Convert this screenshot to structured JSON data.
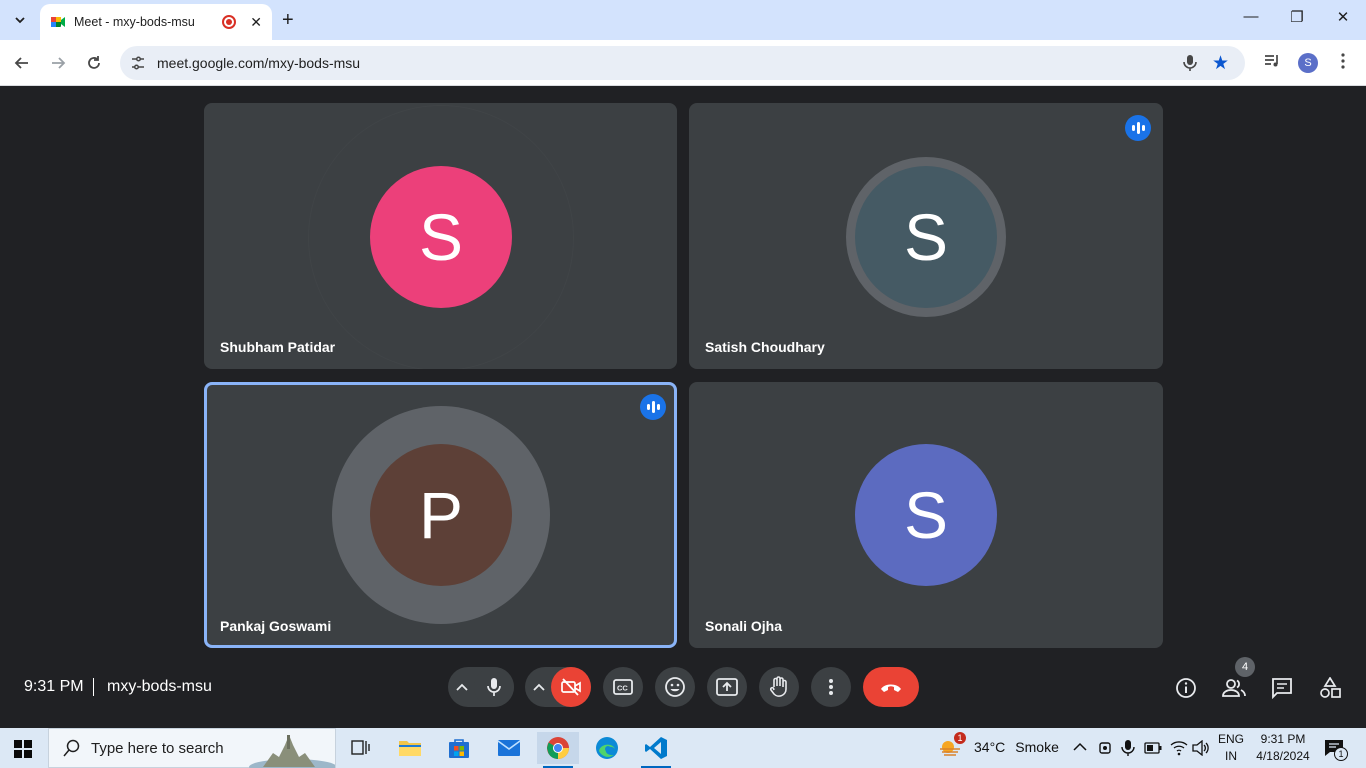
{
  "browser": {
    "tab_title": "Meet - mxy-bods-msu",
    "url": "meet.google.com/mxy-bods-msu",
    "profile_initial": "S"
  },
  "meeting": {
    "time": "9:31 PM",
    "code": "mxy-bods-msu",
    "participant_count": "4",
    "participants": [
      {
        "name": "Shubham Patidar",
        "initial": "S",
        "color": "#ec407a",
        "speaking": false
      },
      {
        "name": "Satish Choudhary",
        "initial": "S",
        "color": "#455a64",
        "speaking": true
      },
      {
        "name": "Pankaj Goswami",
        "initial": "P",
        "color": "#5d4037",
        "speaking": true,
        "pinned_active": true
      },
      {
        "name": "Sonali Ojha",
        "initial": "S",
        "color": "#5c6bc0",
        "speaking": false
      }
    ],
    "controls": [
      "mic-options",
      "microphone",
      "camera-options",
      "camera-off",
      "captions",
      "emoji-reactions",
      "present-screen",
      "raise-hand",
      "more-options",
      "leave-call"
    ],
    "right_controls": [
      "meeting-details",
      "people",
      "chat",
      "activities"
    ]
  },
  "taskbar": {
    "search_placeholder": "Type here to search",
    "weather_temp": "34°C",
    "weather_desc": "Smoke",
    "weather_badge": "1",
    "lang_line1": "ENG",
    "lang_line2": "IN",
    "clock_time": "9:31 PM",
    "clock_date": "4/18/2024",
    "notif_count": "1"
  },
  "colors": {
    "meet_bg": "#202124",
    "tile_bg": "#3c4043",
    "accent_blue": "#1a73e8",
    "danger_red": "#ea4335"
  }
}
